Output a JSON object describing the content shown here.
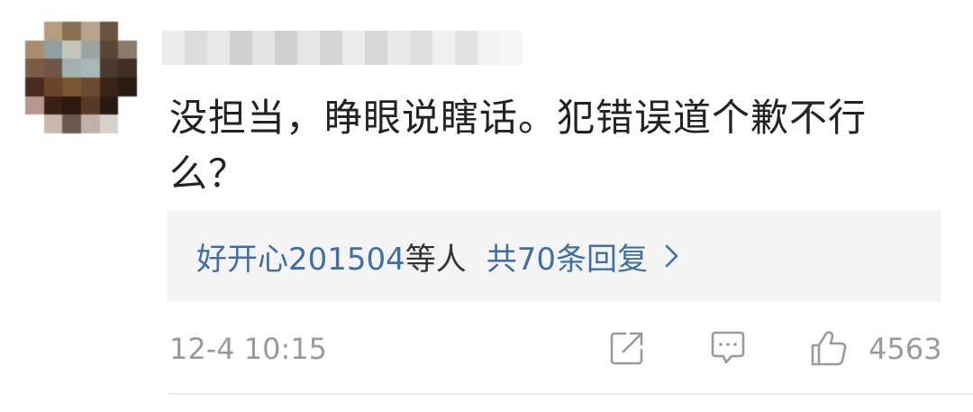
{
  "comment": {
    "text": "没担当，睁眼说瞎话。犯错误道个歉不行么？"
  },
  "replies": {
    "users_link": "好开心201504",
    "users_suffix": "等人",
    "count_link": "共70条回复",
    "chevron_icon": "chevron-right-icon"
  },
  "footer": {
    "timestamp": "12-4 10:15",
    "share_icon": "share-icon",
    "comment_icon": "comment-icon",
    "like_icon": "thumbs-up-icon",
    "like_count": "4563"
  },
  "colors": {
    "link": "#3f6fa5",
    "meta": "#9a9a9a",
    "text": "#222222",
    "reply_bg": "#f4f4f4"
  }
}
